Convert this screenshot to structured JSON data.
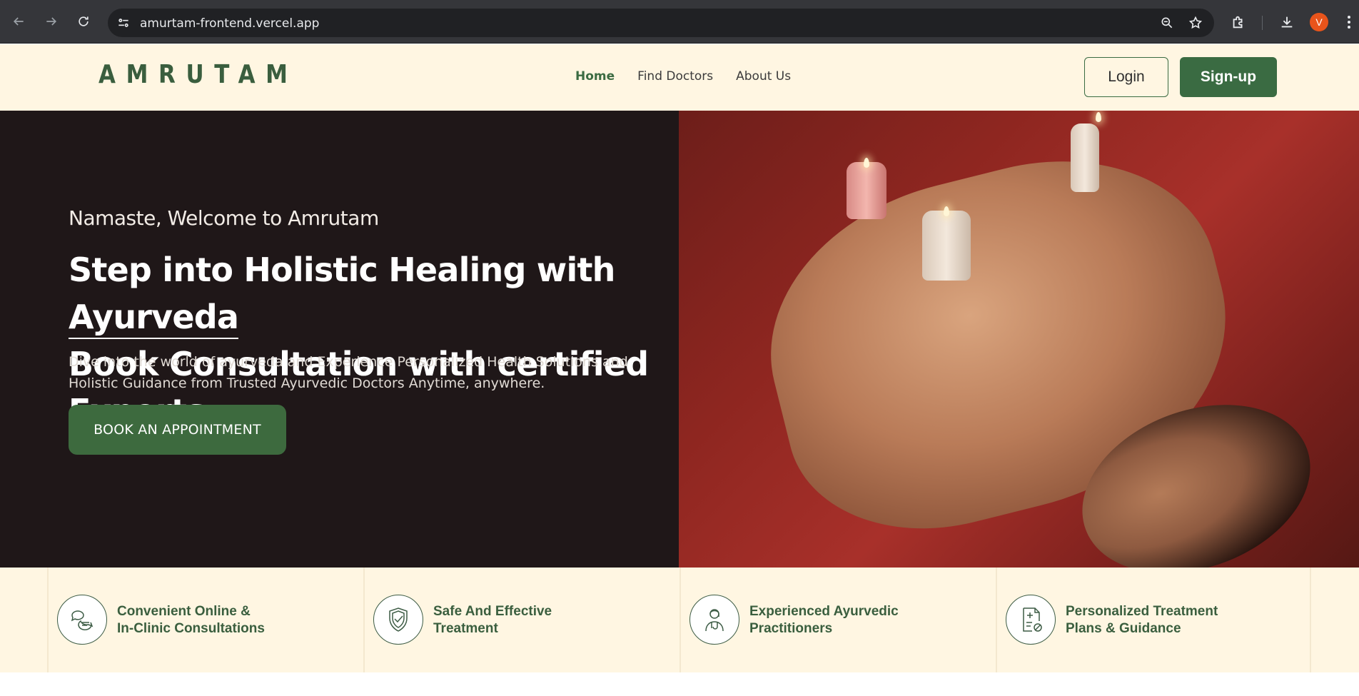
{
  "browser": {
    "url": "amurtam-frontend.vercel.app",
    "profile_initial": "V",
    "icons": [
      "back-icon",
      "forward-icon",
      "reload-icon",
      "site-info-icon",
      "zoom-icon",
      "star-icon",
      "extensions-icon",
      "download-icon",
      "menu-icon"
    ]
  },
  "header": {
    "logo": "AMRUTAM",
    "nav": [
      {
        "label": "Home",
        "active": true
      },
      {
        "label": "Find Doctors",
        "active": false
      },
      {
        "label": "About Us",
        "active": false
      }
    ],
    "login_label": "Login",
    "signup_label": "Sign-up"
  },
  "hero": {
    "greeting": "Namaste, Welcome to Amrutam",
    "headline_part1": "Step into Holistic Healing with ",
    "headline_highlight": "Ayurveda",
    "headline_line2": "Book Consultation with certified Experts.",
    "subtext": "Dive into the world of ayurveda and Experience Personalized Health Solutions and Holistic Guidance from Trusted Ayurvedic Doctors Anytime, anywhere.",
    "cta_label": "BOOK AN APPOINTMENT"
  },
  "features": [
    {
      "icon": "chat-bubbles-icon",
      "label": "Convenient Online &\nIn-Clinic Consultations"
    },
    {
      "icon": "shield-check-icon",
      "label": "Safe And Effective\nTreatment"
    },
    {
      "icon": "doctor-icon",
      "label": "Experienced Ayurvedic\nPractitioners"
    },
    {
      "icon": "prescription-icon",
      "label": "Personalized Treatment\nPlans & Guidance"
    }
  ],
  "colors": {
    "brand_green": "#3a6b42",
    "cream": "#fff6e2",
    "hero_dark": "#1f1718"
  }
}
